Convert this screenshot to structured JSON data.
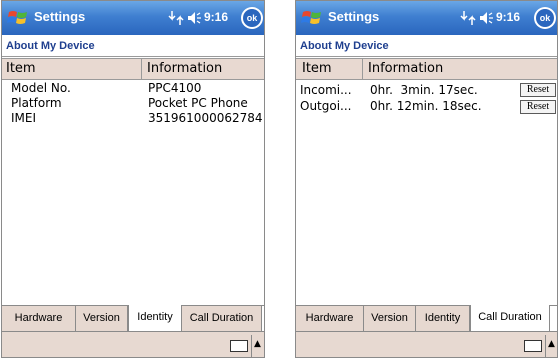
{
  "left": {
    "title": "Settings",
    "clock": "9:16",
    "ok_label": "ok",
    "heading": "About My Device",
    "columns": [
      "Item",
      "Information"
    ],
    "rows": [
      {
        "item": "Model No.",
        "info": "PPC4100"
      },
      {
        "item": "Platform",
        "info": "Pocket PC Phone"
      },
      {
        "item": "IMEI",
        "info": "351961000062784"
      }
    ],
    "tabs": [
      "Hardware",
      "Version",
      "Identity",
      "Call Duration"
    ],
    "active_tab": "Identity"
  },
  "right": {
    "title": "Settings",
    "clock": "9:16",
    "ok_label": "ok",
    "heading": "About My Device",
    "columns": [
      "Item",
      "Information"
    ],
    "rows": [
      {
        "item": "Incomi...",
        "info": "0hr.  3min. 17sec.",
        "button": "Reset"
      },
      {
        "item": "Outgoi...",
        "info": "0hr. 12min. 18sec.",
        "button": "Reset"
      }
    ],
    "tabs": [
      "Hardware",
      "Version",
      "Identity",
      "Call Duration"
    ],
    "active_tab": "Call Duration"
  },
  "colors": {
    "titlebar": "#2a66be",
    "heading_text": "#1f3f8f",
    "header_bg": "#e8d9d1",
    "tab_bg": "#e6d8d0"
  }
}
